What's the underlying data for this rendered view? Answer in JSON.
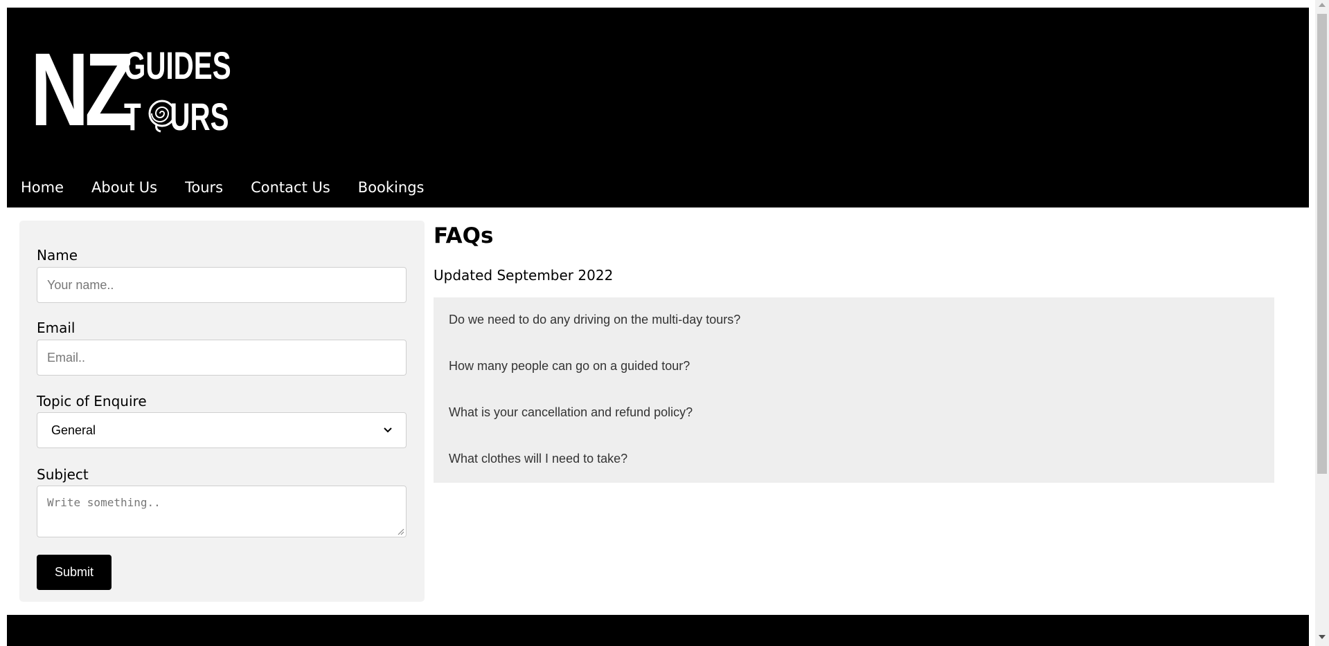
{
  "logo": {
    "big": "NZ",
    "line1": "GUIDES",
    "line2_a": "T",
    "line2_b": "URS"
  },
  "nav": {
    "items": [
      {
        "label": "Home"
      },
      {
        "label": "About Us"
      },
      {
        "label": "Tours"
      },
      {
        "label": "Contact Us"
      },
      {
        "label": "Bookings"
      }
    ]
  },
  "form": {
    "name_label": "Name",
    "name_placeholder": "Your name..",
    "email_label": "Email",
    "email_placeholder": "Email..",
    "topic_label": "Topic of Enquire",
    "topic_value": "General",
    "subject_label": "Subject",
    "subject_placeholder": "Write something..",
    "submit_label": "Submit"
  },
  "faq": {
    "title": "FAQs",
    "updated": "Updated September 2022",
    "items": [
      {
        "q": "Do we need to do any driving on the multi-day tours?"
      },
      {
        "q": "How many people can go on a guided tour?"
      },
      {
        "q": "What is your cancellation and refund policy?"
      },
      {
        "q": "What clothes will I need to take?"
      }
    ]
  },
  "colors": {
    "header_bg": "#000000",
    "panel_bg": "#f2f2f2",
    "faq_bg": "#eeeeee",
    "button_bg": "#000000"
  },
  "icons": {
    "logo_emblem": "koru-spiral-icon",
    "select_arrow": "chevron-down-icon",
    "resize": "resize-grip-icon"
  }
}
